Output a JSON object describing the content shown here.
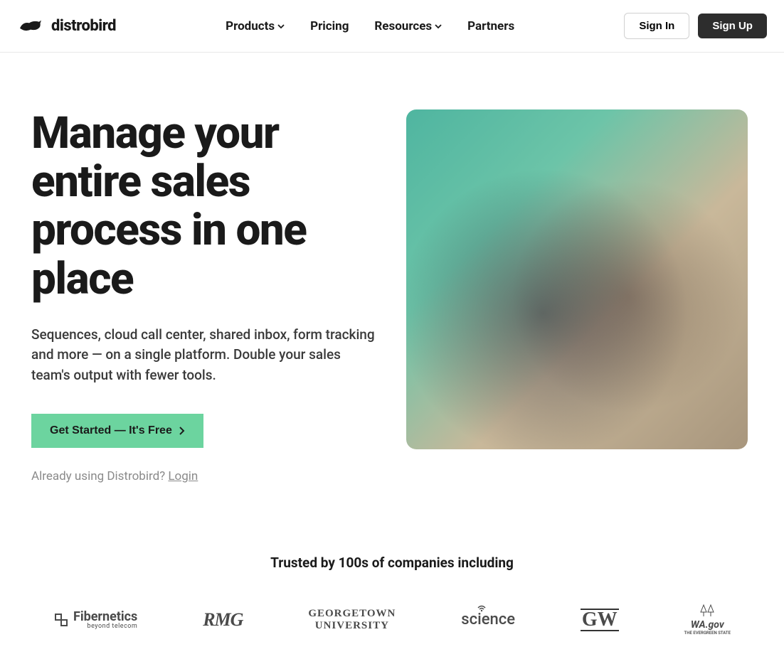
{
  "brand": "distrobird",
  "nav": {
    "products": "Products",
    "pricing": "Pricing",
    "resources": "Resources",
    "partners": "Partners"
  },
  "auth": {
    "signin": "Sign In",
    "signup": "Sign Up"
  },
  "hero": {
    "title": "Manage your entire sales process in one place",
    "subtitle": "Sequences, cloud call center, shared inbox, form tracking and more — on a single platform. Double your sales team's output with fewer tools.",
    "cta": "Get Started — It's Free",
    "login_prompt": "Already using Distrobird? ",
    "login_link": "Login"
  },
  "trusted": {
    "title": "Trusted by 100s of companies including",
    "logos": {
      "fibernetics": "Fibernetics",
      "fibernetics_sub": "beyond telecom",
      "rmg": "RMG",
      "georgetown_1": "GEORGETOWN",
      "georgetown_2": "UNIVERSITY",
      "science": "science",
      "gw": "GW",
      "wa_top": "WA.gov",
      "wa_sub": "THE EVERGREEN STATE"
    }
  }
}
